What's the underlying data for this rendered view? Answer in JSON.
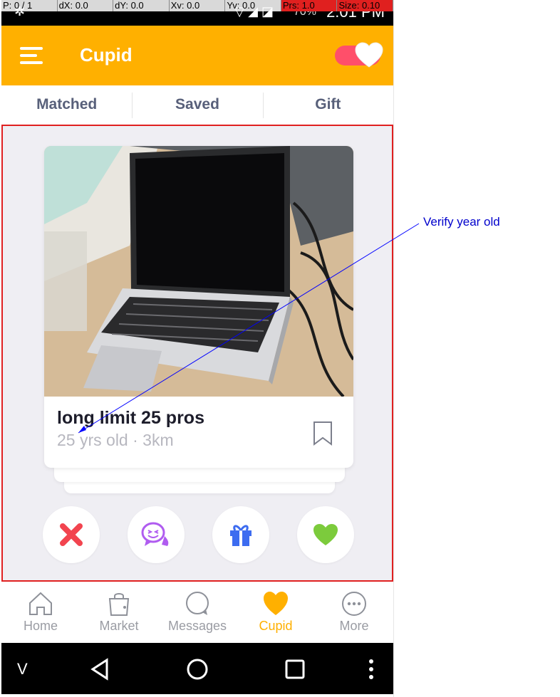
{
  "debug": {
    "p": "P: 0 / 1",
    "dx": "dX: 0.0",
    "dy": "dY: 0.0",
    "xv": "Xv: 0.0",
    "yv": "Yv: 0.0",
    "prs": "Prs: 1.0",
    "size": "Size: 0.10"
  },
  "status": {
    "time": "2:01 PM",
    "battery": "70%"
  },
  "appbar": {
    "title": "Cupid",
    "toggle_on": true
  },
  "tabs": [
    {
      "label": "Matched"
    },
    {
      "label": "Saved"
    },
    {
      "label": "Gift"
    }
  ],
  "card": {
    "name": "long limit 25 pros",
    "meta": "25 yrs old · 3km"
  },
  "actions": [
    {
      "icon": "close-icon",
      "color": "#f2444f"
    },
    {
      "icon": "wink-chat-icon",
      "color": "#b05cf0"
    },
    {
      "icon": "gift-icon",
      "color": "#3d6cf0"
    },
    {
      "icon": "heart-icon",
      "color": "#7ccb3c"
    }
  ],
  "nav": [
    {
      "label": "Home",
      "icon": "home-icon"
    },
    {
      "label": "Market",
      "icon": "bag-icon"
    },
    {
      "label": "Messages",
      "icon": "chat-icon"
    },
    {
      "label": "Cupid",
      "icon": "heart-icon",
      "active": true
    },
    {
      "label": "More",
      "icon": "more-icon"
    }
  ],
  "sysnav": {
    "v_label": "V"
  },
  "annotation": {
    "text": "Verify year old"
  },
  "colors": {
    "accent": "#ffb000",
    "highlight_border": "#e02020",
    "annotation": "#0000cc"
  }
}
